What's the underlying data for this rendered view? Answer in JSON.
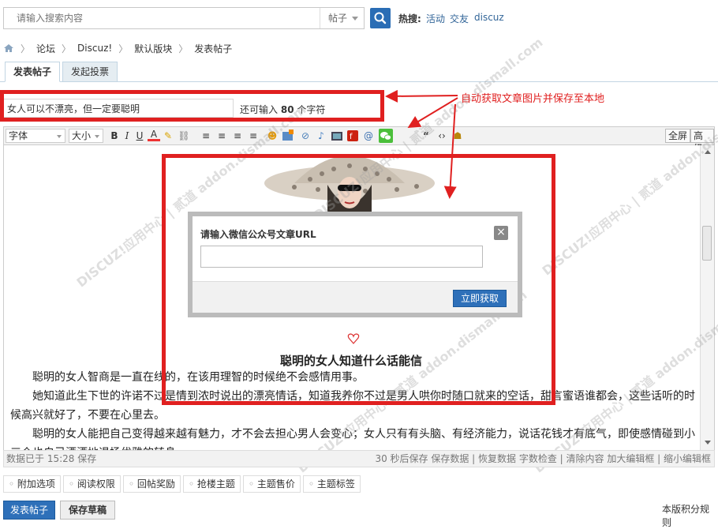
{
  "search": {
    "placeholder": "请输入搜索内容",
    "type_label": "帖子",
    "hot_label": "热搜:",
    "hot_links": [
      "活动",
      "交友",
      "discuz"
    ]
  },
  "breadcrumb": [
    "论坛",
    "Discuz!",
    "默认版块",
    "发表帖子"
  ],
  "tabs": [
    "发表帖子",
    "发起投票"
  ],
  "title": {
    "value": "女人可以不漂亮，但一定要聪明",
    "remain_prefix": "还可输入",
    "remain_count": "80",
    "remain_suffix": "个字符"
  },
  "toolbar": {
    "font_label": "字体",
    "size_label": "大小",
    "fullscreen": "全屏",
    "advanced": "高级",
    "icons": [
      "bold-icon",
      "italic-icon",
      "underline-icon",
      "font-color-icon",
      "background-color-icon",
      "link-icon",
      "align-left-icon",
      "align-center-icon",
      "align-right-icon",
      "align-justify-icon",
      "emoji-icon",
      "image-icon",
      "attachment-icon",
      "music-icon",
      "video-icon",
      "flash-icon",
      "at-icon",
      "wechat-icon",
      "quote-icon",
      "code-icon",
      "hide-icon"
    ]
  },
  "editor": {
    "article_title": "聪明的女人知道什么话能信",
    "paragraphs": [
      "聪明的女人智商是一直在线的，在该用理智的时候绝不会感情用事。",
      "她知道此生下世的许诺不过是情到浓时说出的漂亮情话，知道我养你不过是男人哄你时随口就来的空话，甜言蜜语谁都会，这些话听的时候高兴就好了，不要在心里去。",
      "聪明的女人能把自己变得越来越有魅力，才不会去担心男人会变心；女人只有有头脑、有经济能力，说话花钱才有底气，即使感情碰到小三介也自己洒洒地退场优雅的转身"
    ]
  },
  "modal": {
    "title": "请输入微信公众号文章URL",
    "close": "×",
    "url_value": "",
    "button": "立即获取"
  },
  "statusbar": {
    "left": "数据已于 15:28 保存",
    "right": "30 秒后保存  保存数据 | 恢复数据    字数检查 | 清除内容    加大编辑框 | 缩小编辑框"
  },
  "options": [
    "附加选项",
    "阅读权限",
    "回帖奖励",
    "抢楼主题",
    "主题售价",
    "主题标签"
  ],
  "buttons": {
    "submit": "发表帖子",
    "draft": "保存草稿",
    "rules": "本版积分规则"
  },
  "annotation": {
    "text": "自动获取文章图片并保存至本地",
    "color": "#e02020"
  },
  "watermark": "DISCUZ!应用中心 | 贰道 addon.dismall.com",
  "colors": {
    "accent": "#2e70b9",
    "link": "#336699"
  }
}
